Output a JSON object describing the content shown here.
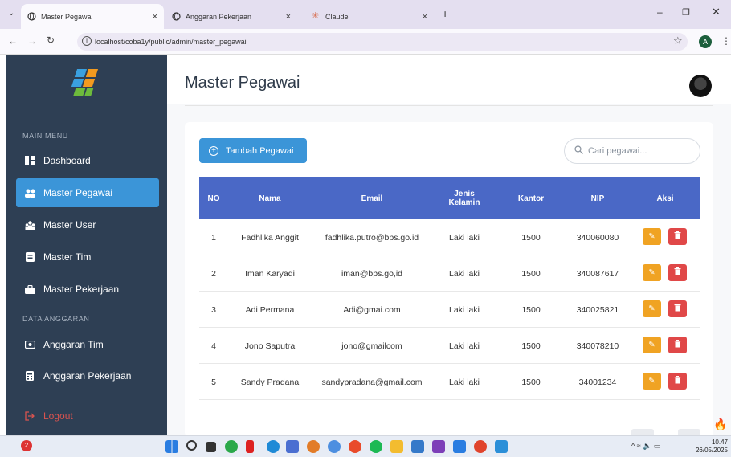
{
  "browser": {
    "tabs": [
      {
        "title": "Master Pegawai",
        "active": true
      },
      {
        "title": "Anggaran Pekerjaan",
        "active": false
      },
      {
        "title": "Claude",
        "active": false
      }
    ],
    "new_tab_label": "+",
    "url": "localhost/coba1y/public/admin/master_pegawai",
    "profile_initial": "A"
  },
  "sidebar": {
    "section_main": "MAIN MENU",
    "section_budget": "DATA ANGGARAN",
    "items": [
      {
        "label": "Dashboard",
        "icon": "dashboard-icon"
      },
      {
        "label": "Master Pegawai",
        "icon": "users-icon",
        "active": true
      },
      {
        "label": "Master User",
        "icon": "user-group-icon"
      },
      {
        "label": "Master Tim",
        "icon": "team-icon"
      },
      {
        "label": "Master Pekerjaan",
        "icon": "briefcase-icon"
      }
    ],
    "budget_items": [
      {
        "label": "Anggaran Tim",
        "icon": "money-icon"
      },
      {
        "label": "Anggaran Pekerjaan",
        "icon": "calculator-icon"
      }
    ],
    "logout_label": "Logout"
  },
  "page": {
    "title": "Master Pegawai",
    "add_button": "Tambah Pegawai",
    "search_placeholder": "Cari pegawai..."
  },
  "table": {
    "headers": [
      "NO",
      "Nama",
      "Email",
      "Jenis Kelamin",
      "Kantor",
      "NIP",
      "Aksi"
    ],
    "rows": [
      {
        "no": "1",
        "nama": "Fadhlika Anggit",
        "email": "fadhlika.putro@bps.go.id",
        "jk": "Laki laki",
        "kantor": "1500",
        "nip": "340060080"
      },
      {
        "no": "2",
        "nama": "Iman Karyadi",
        "email": "iman@bps.go,id",
        "jk": "Laki laki",
        "kantor": "1500",
        "nip": "340087617"
      },
      {
        "no": "3",
        "nama": "Adi Permana",
        "email": "Adi@gmai.com",
        "jk": "Laki laki",
        "kantor": "1500",
        "nip": "340025821"
      },
      {
        "no": "4",
        "nama": "Jono Saputra",
        "email": "jono@gmailcom",
        "jk": "Laki laki",
        "kantor": "1500",
        "nip": "340078210"
      },
      {
        "no": "5",
        "nama": "Sandy Pradana",
        "email": "sandypradana@gmail.com",
        "jk": "Laki laki",
        "kantor": "1500",
        "nip": "34001234"
      }
    ]
  },
  "taskbar": {
    "time": "10.47",
    "date": "26/05/2025"
  },
  "colors": {
    "sidebar_bg": "#2e3f54",
    "accent": "#3b95d8",
    "table_header": "#4a68c6",
    "edit": "#f0a323",
    "delete": "#e04848"
  }
}
